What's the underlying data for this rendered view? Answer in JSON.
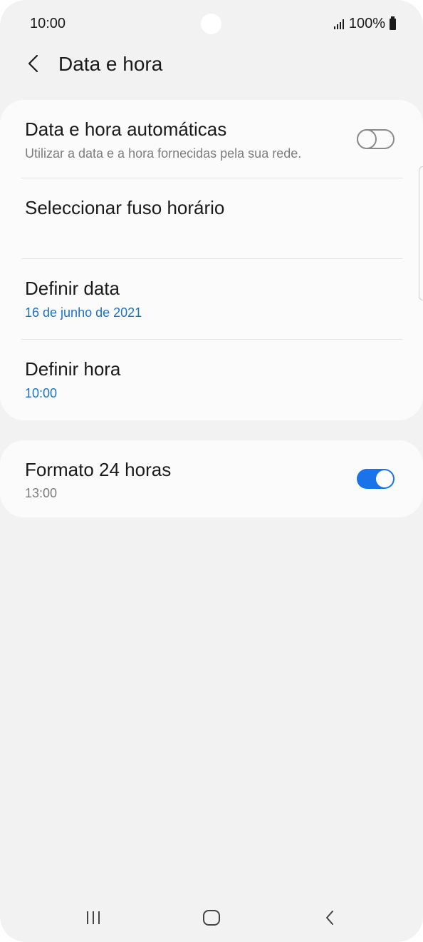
{
  "status_bar": {
    "time": "10:00",
    "battery": "100%",
    "icons": [
      "signal-icon",
      "battery-icon"
    ]
  },
  "header": {
    "title": "Data e hora",
    "back_icon": "chevron-left-icon"
  },
  "settings": {
    "auto_datetime": {
      "title": "Data e hora automáticas",
      "subtitle": "Utilizar a data e a hora fornecidas pela sua rede.",
      "enabled": false
    },
    "timezone": {
      "title": "Seleccionar fuso horário"
    },
    "set_date": {
      "title": "Definir data",
      "value": "16 de junho de 2021"
    },
    "set_time": {
      "title": "Definir hora",
      "value": "10:00"
    },
    "format_24h": {
      "title": "Formato 24 horas",
      "subtitle": "13:00",
      "enabled": true
    }
  },
  "colors": {
    "accent": "#1a73e8",
    "value_blue": "#1a73c9",
    "background": "#f2f2f2",
    "card": "#fbfbfb"
  },
  "nav_bar": {
    "icons": [
      "recents-icon",
      "home-icon",
      "back-icon"
    ]
  }
}
